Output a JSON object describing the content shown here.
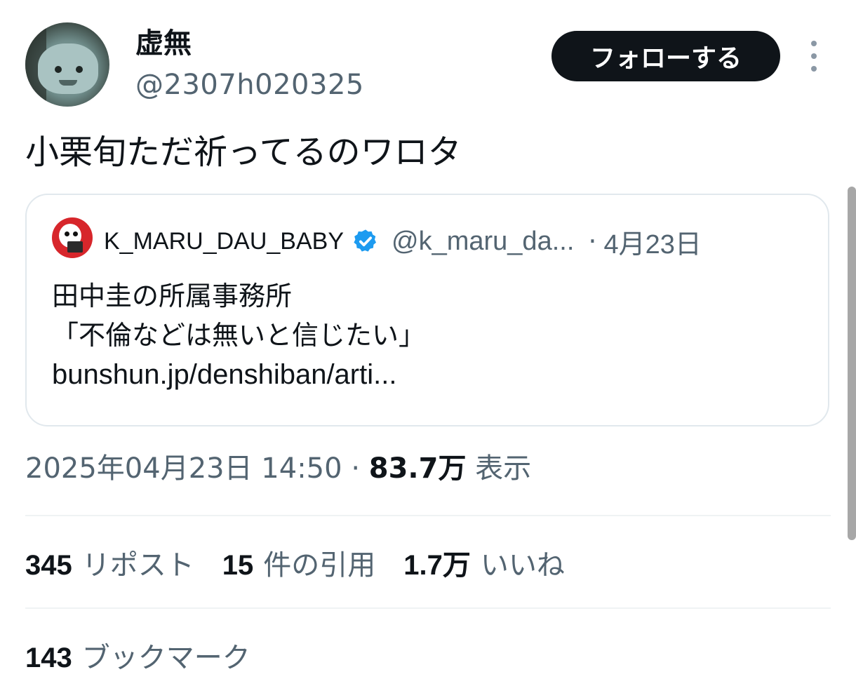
{
  "author": {
    "name": "虚無",
    "handle": "@2307h020325",
    "follow_label": "フォローする"
  },
  "tweet": {
    "text": "小栗旬ただ祈ってるのワロタ"
  },
  "quoted": {
    "name": "K_MARU_DAU_BABY",
    "handle": "@k_maru_da...",
    "dot": "·",
    "date": "4月23日",
    "line1": "田中圭の所属事務所",
    "line2": "「不倫などは無いと信じたい」",
    "link": "bunshun.jp/denshiban/arti..."
  },
  "meta": {
    "datetime": "2025年04月23日 14:50",
    "dot": "·",
    "views": "83.7万",
    "views_label": "表示"
  },
  "stats": {
    "reposts": "345",
    "reposts_label": "リポスト",
    "quotes": "15",
    "quotes_label": "件の引用",
    "likes": "1.7万",
    "likes_label": "いいね"
  },
  "bookmarks": {
    "count": "143",
    "label": "ブックマーク"
  },
  "colors": {
    "text": "#0f1419",
    "secondary": "#536471",
    "verified": "#1d9bf0",
    "border": "#e1e8ed"
  }
}
